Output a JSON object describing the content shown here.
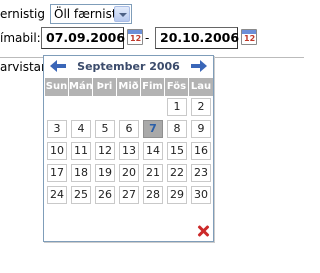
{
  "form": {
    "filter_label": "ernistig",
    "filter_select_value": "Öll færnistig",
    "date_label": "ímabil:",
    "date_from": "07.09.2006",
    "date_separator": "-",
    "date_to": "20.10.2006",
    "third_label": "arvistar"
  },
  "calendar": {
    "month_title": "September 2006",
    "weekdays": [
      "Sun",
      "Mán",
      "Þri",
      "Mið",
      "Fim",
      "Fös",
      "Lau"
    ],
    "weeks": [
      [
        "",
        "",
        "",
        "",
        "",
        "1",
        "2"
      ],
      [
        "3",
        "4",
        "5",
        "6",
        "7",
        "8",
        "9"
      ],
      [
        "10",
        "11",
        "12",
        "13",
        "14",
        "15",
        "16"
      ],
      [
        "17",
        "18",
        "19",
        "20",
        "21",
        "22",
        "23"
      ],
      [
        "24",
        "25",
        "26",
        "27",
        "28",
        "29",
        "30"
      ]
    ],
    "selected_day": "7",
    "icons": {
      "prev": "arrow-left-icon",
      "next": "arrow-right-icon",
      "close": "close-x-icon",
      "calendar": "calendar-icon"
    },
    "calendar_icon_text": "12"
  },
  "colors": {
    "header_gray": "#b3b3b3",
    "accent_blue": "#3a66b8",
    "close_red": "#cc2a2a"
  }
}
